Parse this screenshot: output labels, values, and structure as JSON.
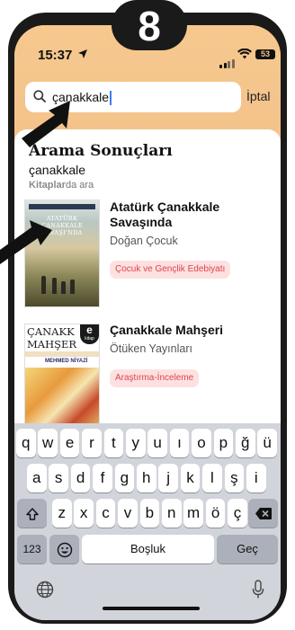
{
  "badge": "8",
  "status": {
    "time": "15:37",
    "battery": "53"
  },
  "search": {
    "query": "çanakkale",
    "cancel": "İptal"
  },
  "results": {
    "heading": "Arama Sonuçları",
    "term": "çanakkale",
    "hint_prefix": "Kitaplar",
    "hint_suffix": "da ara"
  },
  "books": [
    {
      "title_line1": "Atatürk Çanakkale",
      "title_line2": "Savaşında",
      "publisher": "Doğan Çocuk",
      "category": "Çocuk ve Gençlik Edebiyatı",
      "cover_title": "ATATÜRK ÇANAKKALE SAVAŞI'NDA"
    },
    {
      "title_line1": "Çanakkale Mahşeri",
      "publisher": "Ötüken  Yayınları",
      "category": "Araştırma-İnceleme",
      "cover_title_line1": "ÇANAKK",
      "cover_title_line2": "MAHŞER",
      "cover_author": "MEHMED NİYAZİ",
      "ebook_letter": "e",
      "ebook_label": "kitap"
    }
  ],
  "keyboard": {
    "row1": [
      "q",
      "w",
      "e",
      "r",
      "t",
      "y",
      "u",
      "ı",
      "o",
      "p",
      "ğ",
      "ü"
    ],
    "row2": [
      "a",
      "s",
      "d",
      "f",
      "g",
      "h",
      "j",
      "k",
      "l",
      "ş",
      "i"
    ],
    "row3": [
      "z",
      "x",
      "c",
      "v",
      "b",
      "n",
      "m",
      "ö",
      "ç"
    ],
    "numbers": "123",
    "space": "Boşluk",
    "go": "Geç"
  },
  "colors": {
    "header": "#f3c28a",
    "tag_bg": "#fde1e1",
    "tag_text": "#e0434b",
    "keyboard": "#d1d4da"
  }
}
